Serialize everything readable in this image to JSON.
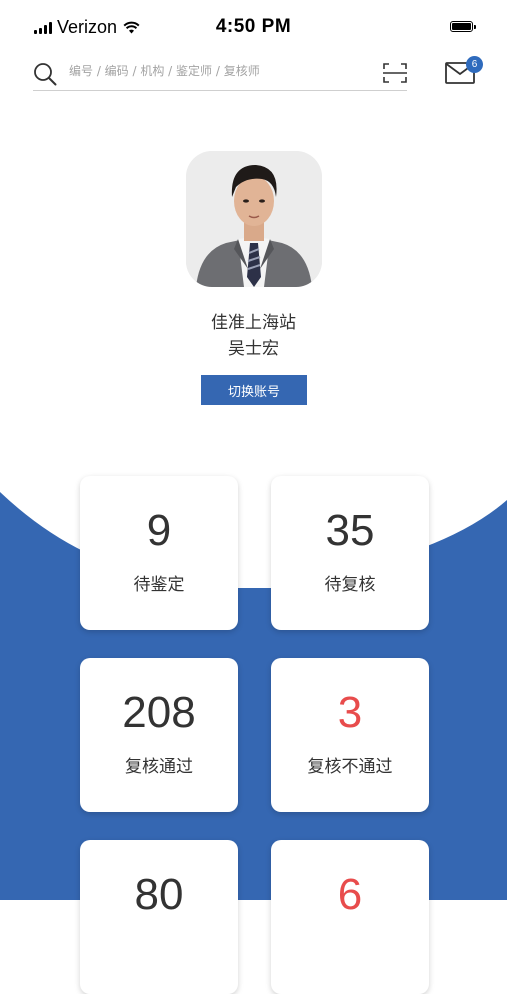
{
  "status_bar": {
    "carrier": "Verizon",
    "time": "4:50 PM"
  },
  "search": {
    "placeholder": "编号 / 编码 / 机构 / 鉴定师 / 复核师"
  },
  "mail": {
    "badge_count": "6"
  },
  "profile": {
    "station": "佳准上海站",
    "name": "吴士宏",
    "switch_label": "切换账号"
  },
  "stats": [
    {
      "value": "9",
      "label": "待鉴定"
    },
    {
      "value": "35",
      "label": "待复核"
    },
    {
      "value": "208",
      "label": "复核通过"
    },
    {
      "value": "3",
      "label": "复核不通过"
    },
    {
      "value": "80",
      "label": ""
    },
    {
      "value": "6",
      "label": ""
    }
  ],
  "colors": {
    "brand_blue": "#3567b2",
    "alert_red": "#e84c4c"
  }
}
